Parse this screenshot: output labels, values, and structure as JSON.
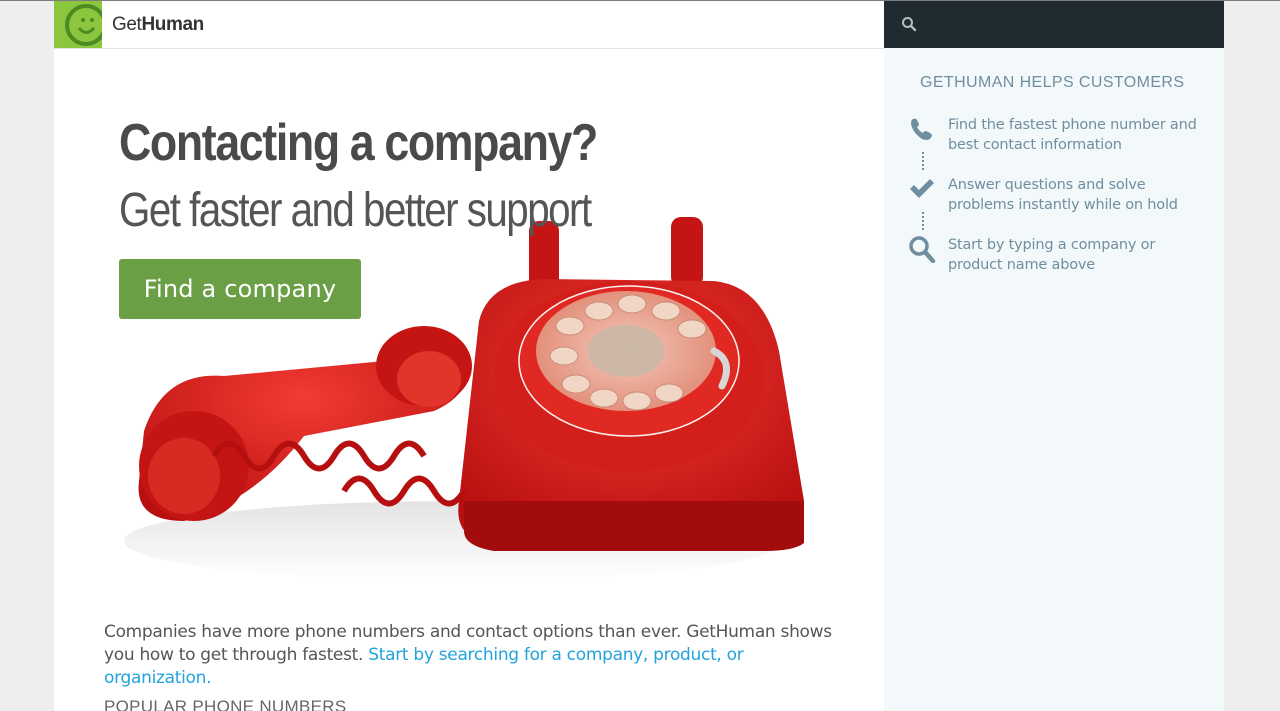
{
  "header": {
    "brand_light": "Get",
    "brand_bold": "Human",
    "search_placeholder": ""
  },
  "hero": {
    "title": "Contacting a company?",
    "subtitle": "Get faster and better support",
    "cta_label": "Find a company"
  },
  "intro": {
    "text": "Companies have more phone numbers and contact options than ever. GetHuman shows you how to get through fastest.",
    "link_text": "Start by searching for a company, product, or organization."
  },
  "popular_heading": "POPULAR PHONE NUMBERS",
  "sidebar": {
    "title": "GETHUMAN HELPS CUSTOMERS",
    "steps": [
      {
        "icon": "phone-icon",
        "text": "Find the fastest phone number and best contact information"
      },
      {
        "icon": "check-icon",
        "text": "Answer questions and solve problems instantly while on hold"
      },
      {
        "icon": "search-icon",
        "text": "Start by typing a company or product name above"
      }
    ]
  },
  "colors": {
    "logo_green": "#8cc63e",
    "header_dark": "#1f2a31",
    "button_green": "#6a9f45",
    "link_blue": "#22a3dc",
    "sidebar_bg": "#f3f8fa",
    "sidebar_text": "#6f8fa0"
  }
}
